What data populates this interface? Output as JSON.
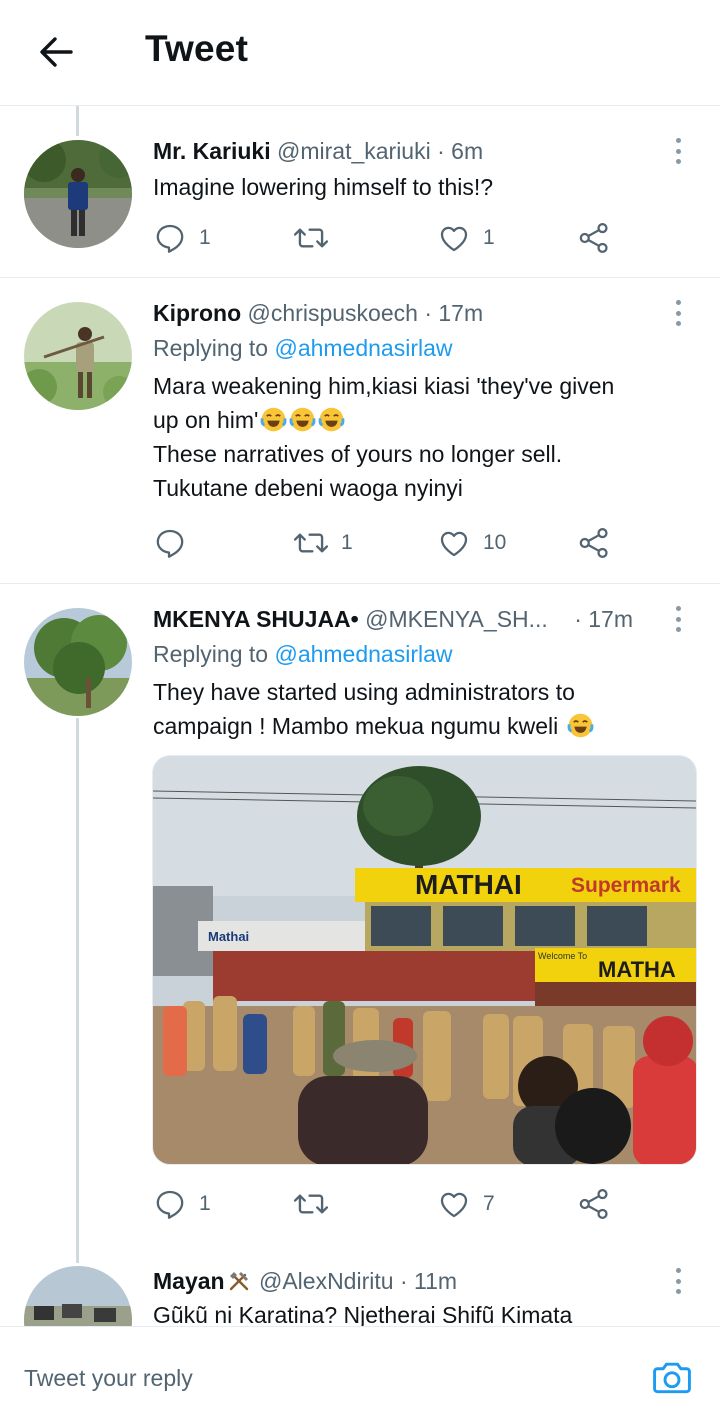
{
  "header": {
    "title": "Tweet"
  },
  "tweets": [
    {
      "name": "Mr. Kariuki",
      "handle": "@mirat_kariuki",
      "time": "· 6m",
      "text": "Imagine lowering himself to this!?",
      "replies": "1",
      "retweets": "",
      "likes": "1"
    },
    {
      "name": "Kiprono",
      "handle": "@chrispuskoech",
      "time": "· 17m",
      "replying_label": "Replying to",
      "replying_to": "@ahmednasirlaw",
      "line1": "Mara weakening him,kiasi kiasi 'they've given",
      "line2": "up on him'",
      "line3": "These narratives of yours no longer sell.",
      "line4": "Tukutane debeni waoga nyinyi",
      "replies": "",
      "retweets": "1",
      "likes": "10"
    },
    {
      "name": "MKENYA SHUJAA•",
      "handle": "@MKENYA_SH...",
      "time": "· 17m",
      "replying_label": "Replying to",
      "replying_to": "@ahmednasirlaw",
      "line1": "They have started using administrators to",
      "line2": "campaign ! Mambo mekua ngumu kweli",
      "photo_sign": "MATHAI Supermarket",
      "photo_sign_main": "MATHAI",
      "photo_sign_sub": "Supermark",
      "photo_sign2": "MATHA",
      "photo_sign3": "Mathai",
      "photo_welcome": "Welcome To",
      "replies": "1",
      "retweets": "",
      "likes": "7"
    },
    {
      "name": "Mayan",
      "handle": "@AlexNdiritu",
      "time": "· 11m",
      "text": "Gũkũ ni Karatina? Njetherai Shifũ Kimata"
    }
  ],
  "reply_bar": {
    "placeholder": "Tweet your reply"
  },
  "colors": {
    "link": "#1d9bf0",
    "secondary": "#536471",
    "divider": "#e6ecf0",
    "thread": "#cfd9de"
  }
}
